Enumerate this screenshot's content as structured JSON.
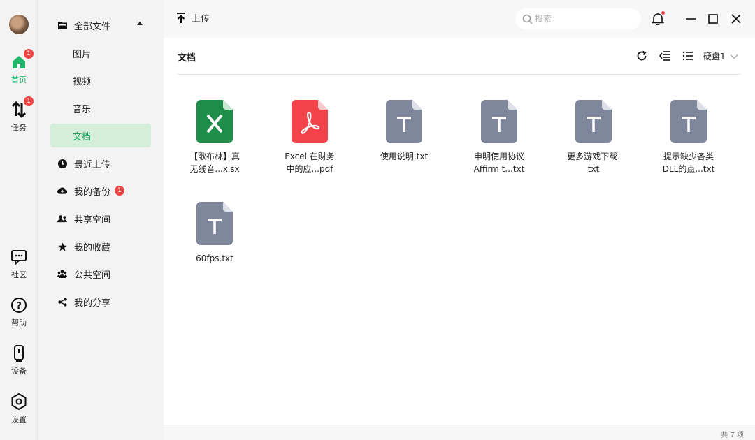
{
  "rail": {
    "items": [
      {
        "label": "首页",
        "badge": "1"
      },
      {
        "label": "任务",
        "badge": "1"
      },
      {
        "label": "社区"
      },
      {
        "label": "帮助"
      },
      {
        "label": "设备"
      },
      {
        "label": "设置"
      }
    ]
  },
  "sidebar": {
    "all_files": "全部文件",
    "items": [
      {
        "label": "图片"
      },
      {
        "label": "视频"
      },
      {
        "label": "音乐"
      },
      {
        "label": "文档"
      },
      {
        "label": "最近上传"
      },
      {
        "label": "我的备份",
        "badge": "1"
      },
      {
        "label": "共享空间"
      },
      {
        "label": "我的收藏"
      },
      {
        "label": "公共空间"
      },
      {
        "label": "我的分享"
      }
    ]
  },
  "topbar": {
    "upload_label": "上传",
    "search_placeholder": "搜索"
  },
  "content": {
    "title": "文档",
    "disk_label": "硬盘1",
    "files": [
      {
        "line1": "【歌布林】真",
        "line2": "无线音...xlsx",
        "type": "xlsx"
      },
      {
        "line1": "Excel 在财务",
        "line2": "中的应...pdf",
        "type": "pdf"
      },
      {
        "line1": "使用说明.txt",
        "line2": "",
        "type": "txt"
      },
      {
        "line1": "申明使用协议",
        "line2": "Affirm t...txt",
        "type": "txt"
      },
      {
        "line1": "更多游戏下载.",
        "line2": "txt",
        "type": "txt"
      },
      {
        "line1": "提示缺少各类",
        "line2": "DLL的点...txt",
        "type": "txt"
      },
      {
        "line1": "60fps.txt",
        "line2": "",
        "type": "txt"
      }
    ],
    "item_count": "共 7 项"
  },
  "colors": {
    "accent": "#1fb56a",
    "active_bg": "#d4eed9",
    "badge": "#ef4444",
    "xlsx": "#1e8e4a",
    "pdf": "#f2434a",
    "txt": "#7f879c"
  }
}
